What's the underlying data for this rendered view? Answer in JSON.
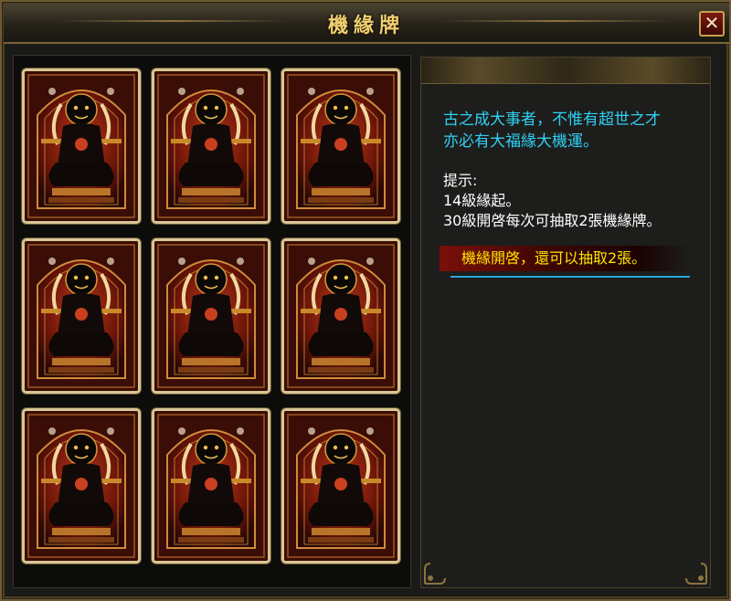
{
  "window": {
    "title": "機緣牌",
    "close_label": "✕"
  },
  "cards": [
    {
      "face": "deity-card"
    },
    {
      "face": "deity-card"
    },
    {
      "face": "deity-card"
    },
    {
      "face": "deity-card"
    },
    {
      "face": "deity-card"
    },
    {
      "face": "deity-card"
    },
    {
      "face": "deity-card"
    },
    {
      "face": "deity-card"
    },
    {
      "face": "deity-card"
    }
  ],
  "info": {
    "intro_line1": "古之成大事者，不惟有超世之才",
    "intro_line2": "亦必有大福緣大機運。",
    "hint_title": "提示:",
    "hint_line1": "14級緣起。",
    "hint_line2": "30級開啓每次可抽取2張機緣牌。",
    "status": "機緣開啓，還可以抽取2張。"
  },
  "colors": {
    "title": "#f0d070",
    "intro_text": "#2fd0f4",
    "hint_text": "#ffffff",
    "status_text": "#ffe400",
    "card_border": "#d9c595"
  }
}
